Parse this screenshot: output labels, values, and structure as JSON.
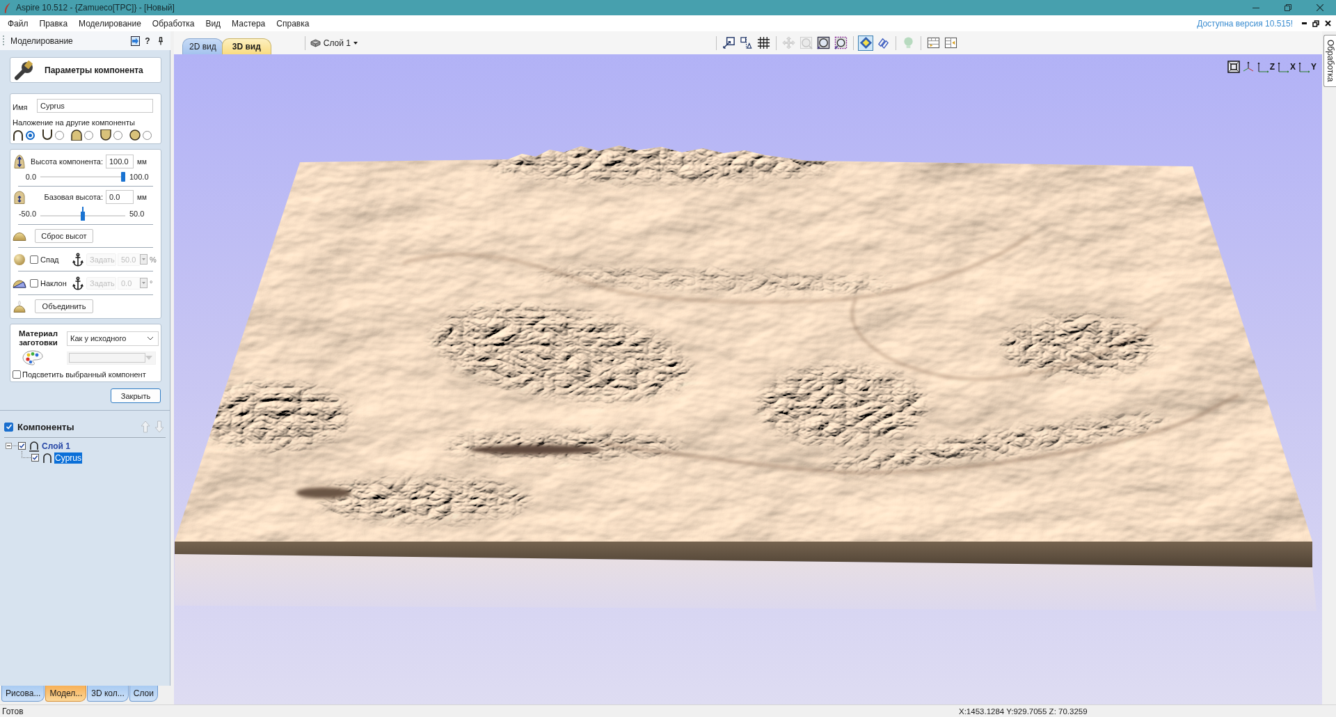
{
  "window": {
    "title": "Aspire 10.512 - {Zamueco[TPC]} - [Новый]"
  },
  "menu": [
    "Файл",
    "Правка",
    "Моделирование",
    "Обработка",
    "Вид",
    "Мастера",
    "Справка"
  ],
  "update_notice": "Доступна версия 10.515!",
  "panel": {
    "title": "Моделирование",
    "help": "?",
    "header": "Параметры компонента",
    "name": {
      "label": "Имя",
      "value": "Cyprus"
    },
    "overlap": {
      "label": "Наложение на другие компоненты",
      "options": [
        {
          "kind": "add",
          "selected": true
        },
        {
          "kind": "subtract",
          "selected": false
        },
        {
          "kind": "merge",
          "selected": false
        },
        {
          "kind": "low",
          "selected": false
        },
        {
          "kind": "multiply",
          "selected": false
        }
      ]
    },
    "height": {
      "label": "Высота компонента:",
      "value": "100.0",
      "unit": "мм",
      "min": "0.0",
      "max": "100.0",
      "level": 1
    },
    "base_height": {
      "label": "Базовая высота:",
      "value": "0.0",
      "unit": "мм",
      "min": "-50.0",
      "max": "50.0",
      "level": 0.5
    },
    "reset_button": "Сброс высот",
    "shaping": [
      {
        "kind": "fade",
        "label": "Спад",
        "checked": false,
        "button": {
          "label": "Задать",
          "disabled": true
        },
        "spin": {
          "value": "50.0",
          "disabled": true
        },
        "unit": "%"
      },
      {
        "kind": "tilt",
        "label": "Наклон",
        "checked": false,
        "button": {
          "label": "Задать",
          "disabled": true
        },
        "spin": {
          "value": "0.0",
          "disabled": true
        },
        "unit": "°"
      }
    ],
    "merge_button": "Объединить",
    "material": {
      "label": "Материал заготовки",
      "value": "Как у исходного",
      "color_picker": {
        "disabled": true
      }
    },
    "highlight": {
      "label": "Подсветить выбранный компонент",
      "checked": false
    },
    "close_button": "Закрыть"
  },
  "components": {
    "label": "Компоненты",
    "checked": true,
    "move_buttons": [
      {
        "kind": "up",
        "disabled": true
      },
      {
        "kind": "down",
        "disabled": true
      }
    ],
    "tree": [
      {
        "label": "Слой 1",
        "checked": true,
        "expanded": true,
        "selected": false,
        "children": [
          {
            "label": "Cyprus",
            "checked": true,
            "selected": true
          }
        ]
      }
    ]
  },
  "panel_tabs": [
    {
      "label": "Рисова...",
      "selected": false
    },
    {
      "label": "Модел...",
      "selected": true
    },
    {
      "label": "3D кол...",
      "selected": false
    },
    {
      "label": "Слои",
      "selected": false
    }
  ],
  "view_tabs": [
    {
      "label": "2D вид",
      "selected": false
    },
    {
      "label": "3D вид",
      "selected": true
    }
  ],
  "layer_selector": {
    "value": "Слой 1"
  },
  "toolbar": [
    [
      {
        "kind": "scale",
        "disabled": false,
        "selected": false
      },
      {
        "kind": "mirror",
        "disabled": false,
        "selected": false
      },
      {
        "kind": "grid",
        "disabled": false,
        "selected": false
      }
    ],
    [
      {
        "kind": "pan",
        "disabled": true,
        "selected": false
      },
      {
        "kind": "zoom",
        "disabled": true,
        "selected": false
      },
      {
        "kind": "zoom-fit",
        "disabled": false,
        "selected": false
      },
      {
        "kind": "zoom-box",
        "disabled": false,
        "selected": false
      }
    ],
    [
      {
        "kind": "render",
        "disabled": false,
        "selected": true
      },
      {
        "kind": "wireframe",
        "disabled": false,
        "selected": false
      }
    ],
    [
      {
        "kind": "light",
        "disabled": true,
        "selected": false
      }
    ],
    [
      {
        "kind": "split-h",
        "disabled": false,
        "selected": false
      },
      {
        "kind": "split-v",
        "disabled": false,
        "selected": false
      }
    ]
  ],
  "view_buttons": [
    {
      "kind": "fit"
    },
    {
      "kind": "iso"
    },
    {
      "kind": "axis",
      "label": "Z"
    },
    {
      "kind": "axis",
      "label": "X"
    },
    {
      "kind": "axis",
      "label": "Y"
    }
  ],
  "side_tab": "Обработка",
  "status_bar": {
    "text": "Готов",
    "coordinates": "X:1453.1284 Y:929.7055 Z: 70.3259"
  }
}
